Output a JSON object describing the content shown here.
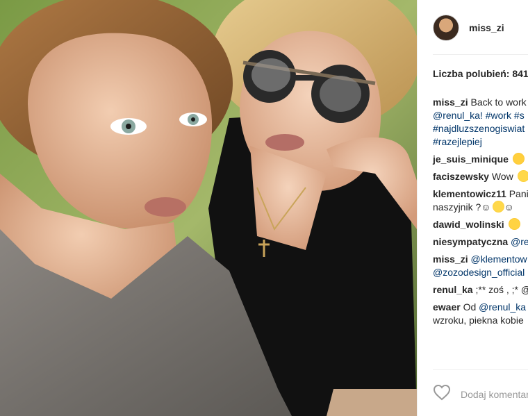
{
  "post": {
    "username": "miss_zi",
    "likes_label": "Liczba polubień: 841",
    "add_comment_placeholder": "Dodaj komentarz..."
  },
  "comments": [
    {
      "user": "miss_zi",
      "text": " Back to work"
    },
    {
      "tag": "@renul_ka! #work #s"
    },
    {
      "tag": "#najdluzszenogiswiat"
    },
    {
      "tag": "#razejlepiej"
    },
    {
      "user": "je_suis_minique",
      "text": " "
    },
    {
      "user": "faciszewsky",
      "text": " Wow "
    },
    {
      "user": "klementowicz11",
      "text": " Pani"
    },
    {
      "text": "naszyjnik ?☺",
      "text2": "☺"
    },
    {
      "user": "dawid_wolinski",
      "text": " "
    },
    {
      "user": "niesympatyczna",
      "tag": " @re"
    },
    {
      "user": "miss_zi",
      "tag": " @klementow"
    },
    {
      "tag": "@zozodesign_official"
    },
    {
      "user": "renul_ka",
      "text": " ;** zoś , ;* @"
    },
    {
      "user": "ewaer",
      "text": " Od ",
      "tag": "@renul_ka"
    },
    {
      "text": "wzroku, piekna kobie"
    }
  ],
  "icons": {
    "avatar": "profile-avatar",
    "like": "heart-outline-icon"
  },
  "colors": {
    "link": "#003569",
    "text": "#262626",
    "muted": "#999999"
  }
}
